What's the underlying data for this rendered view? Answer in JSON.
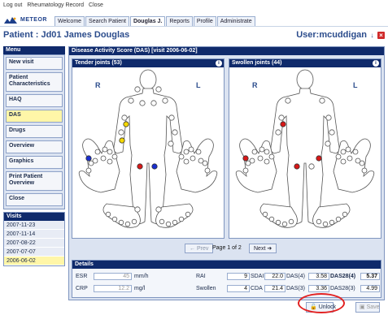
{
  "top_links": [
    "Log out",
    "Rheumatology Record",
    "Close"
  ],
  "logo": "METEOR",
  "tabs": [
    "Welcome",
    "Search Patient",
    "Douglas J.",
    "Reports",
    "Profile",
    "Administrate"
  ],
  "active_tab": 2,
  "patient_title": "Patient : Jd01 James Douglas",
  "user_label": "User:mcuddigan",
  "menu": {
    "title": "Menu",
    "items": [
      "New visit",
      "Patient Characteristics",
      "HAQ",
      "DAS",
      "Drugs",
      "Overview",
      "Graphics",
      "Print Patient Overview",
      "Close"
    ],
    "active": 3
  },
  "visits": {
    "title": "Visits",
    "items": [
      "2007-11-23",
      "2007-11-14",
      "2007-08-22",
      "2007-07-07",
      "2006-06-02"
    ],
    "active": 4
  },
  "main_title": "Disease Activity Score (DAS) [visit 2006-06-02]",
  "tender": {
    "title": "Tender joints (53)",
    "r": "R",
    "l": "L"
  },
  "swollen": {
    "title": "Swollen joints (44)",
    "r": "R",
    "l": "L"
  },
  "pager": {
    "prev": "Prev",
    "label": "Page 1 of 2",
    "next": "Next"
  },
  "details": {
    "title": "Details",
    "esr_label": "ESR",
    "esr_value": "45",
    "esr_unit": "mm/h",
    "crp_label": "CRP",
    "crp_value": "12.2",
    "crp_unit": "mg/l",
    "rai_label": "RAI",
    "rai_value": "9",
    "swollen_label": "Swollen",
    "swollen_value": "4",
    "sdai_label": "SDAI",
    "sdai_value": "22.0",
    "cda_label": "CDA",
    "cda_value": "21.4",
    "das4_label": "DAS(4)",
    "das4_value": "3.58",
    "das3_label": "DAS(3)",
    "das3_value": "3.36",
    "das28_4_label": "DAS28(4)",
    "das28_4_value": "5.37",
    "das28_3_label": "DAS28(3)",
    "das28_3_value": "4.99"
  },
  "buttons": {
    "unlock": "Unlock",
    "save": "Save"
  },
  "colors": {
    "navy": "#0f2a6b",
    "tender_yellow": "#f5d800",
    "tender_blue": "#1a2fd0",
    "tender_red": "#d81818",
    "swollen_red": "#d81818",
    "highlight": "#fff6a8",
    "annotation": "#e22222"
  }
}
